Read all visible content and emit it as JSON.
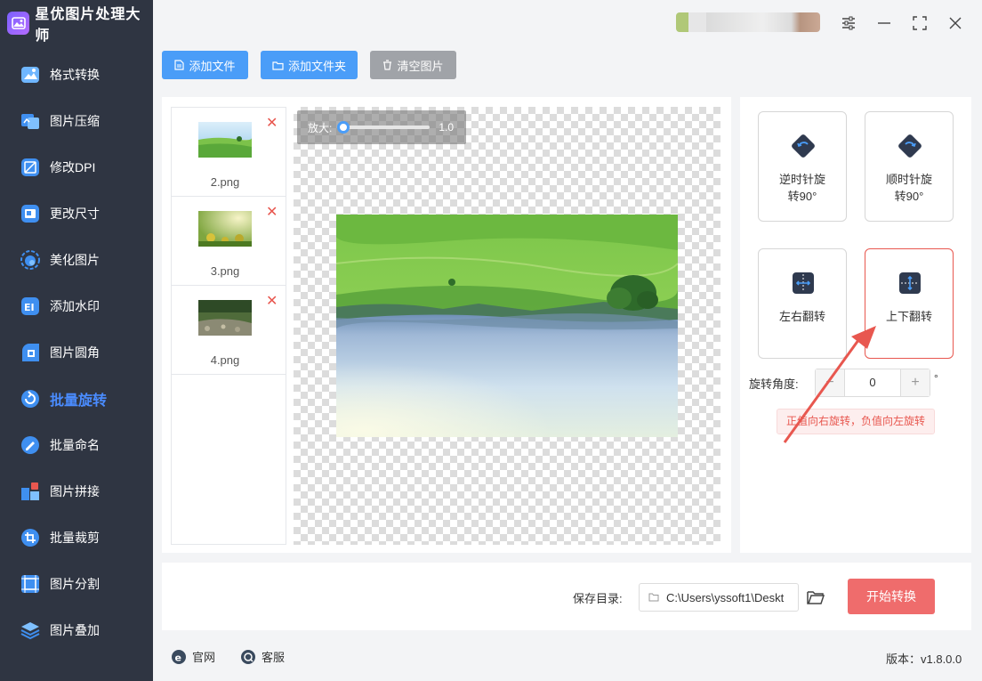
{
  "app": {
    "title": "星优图片处理大师"
  },
  "sidebar": {
    "items": [
      {
        "label": "格式转换",
        "icon": "format-convert-icon"
      },
      {
        "label": "图片压缩",
        "icon": "compress-icon"
      },
      {
        "label": "修改DPI",
        "icon": "dpi-icon"
      },
      {
        "label": "更改尺寸",
        "icon": "resize-icon"
      },
      {
        "label": "美化图片",
        "icon": "beautify-icon"
      },
      {
        "label": "添加水印",
        "icon": "watermark-icon"
      },
      {
        "label": "图片圆角",
        "icon": "round-corner-icon"
      },
      {
        "label": "批量旋转",
        "icon": "rotate-icon",
        "active": true
      },
      {
        "label": "批量命名",
        "icon": "rename-icon"
      },
      {
        "label": "图片拼接",
        "icon": "stitch-icon"
      },
      {
        "label": "批量裁剪",
        "icon": "crop-icon"
      },
      {
        "label": "图片分割",
        "icon": "split-icon"
      },
      {
        "label": "图片叠加",
        "icon": "overlay-icon"
      }
    ]
  },
  "toolbar": {
    "add_file": "添加文件",
    "add_folder": "添加文件夹",
    "clear": "清空图片"
  },
  "files": [
    {
      "name": "2.png"
    },
    {
      "name": "3.png"
    },
    {
      "name": "4.png"
    }
  ],
  "zoom": {
    "label": "放大:",
    "value": "1.0",
    "level": 0.0
  },
  "operations": {
    "ccw": {
      "line1": "逆时针旋",
      "line2": "转90°"
    },
    "cw": {
      "line1": "顺时针旋",
      "line2": "转90°"
    },
    "flip_h": {
      "label": "左右翻转"
    },
    "flip_v": {
      "label": "上下翻转"
    }
  },
  "angle": {
    "label": "旋转角度:",
    "minus": "−",
    "value": "0",
    "plus": "+",
    "unit": "°",
    "hint": "正值向右旋转，负值向左旋转"
  },
  "save": {
    "label": "保存目录:",
    "path": "C:\\Users\\yssoft1\\Deskt"
  },
  "start_button": "开始转换",
  "footer": {
    "website": "官网",
    "support": "客服",
    "version": "版本：v1.8.0.0"
  },
  "colors": {
    "sidebar_bg": "#2f3542",
    "accent_blue": "#4a9df8",
    "active_nav": "#4a8cff",
    "danger": "#e8574f",
    "start_btn": "#ef6c6c"
  }
}
